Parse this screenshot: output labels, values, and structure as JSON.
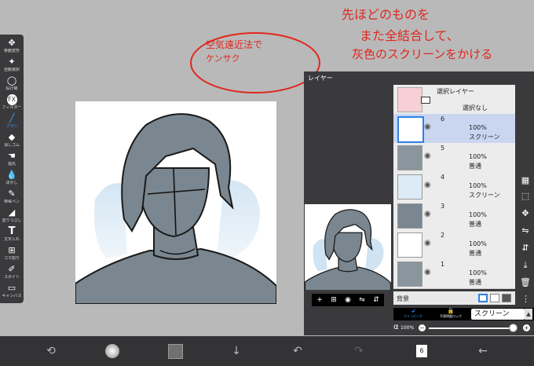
{
  "toolbar": {
    "tools": [
      {
        "label": "移動変形",
        "icon": "move-icon"
      },
      {
        "label": "自動選択",
        "icon": "magic-wand-icon"
      },
      {
        "label": "投げ縄",
        "icon": "lasso-icon"
      },
      {
        "label": "フィルター",
        "icon": "fx-icon"
      },
      {
        "label": "ブラシ",
        "icon": "brush-icon"
      },
      {
        "label": "消しゴム",
        "icon": "eraser-icon"
      },
      {
        "label": "指先",
        "icon": "finger-icon"
      },
      {
        "label": "ぼかし",
        "icon": "blur-icon"
      },
      {
        "label": "特殊ペン",
        "icon": "special-pen-icon"
      },
      {
        "label": "塗りつぶし",
        "icon": "fill-icon"
      },
      {
        "label": "文字入れ",
        "icon": "text-icon"
      },
      {
        "label": "コマ割り",
        "icon": "frame-icon"
      },
      {
        "label": "スポイト",
        "icon": "eyedropper-icon"
      },
      {
        "label": "キャンバス",
        "icon": "canvas-icon"
      }
    ],
    "active_index": 4
  },
  "annotations": {
    "left_line1": "空気遠近法で",
    "left_line2": "ケンサク",
    "right_line1": "先ほどのものを",
    "right_line2": "また全結合して、",
    "right_line3": "灰色のスクリーンをかける"
  },
  "layer_panel": {
    "title": "レイヤー",
    "selection_layer": {
      "label": "選択レイヤー",
      "sub": "選択なし"
    },
    "layers": [
      {
        "num": "6",
        "opacity": "100%",
        "mode": "スクリーン",
        "selected": true
      },
      {
        "num": "5",
        "opacity": "100%",
        "mode": "普通",
        "selected": false
      },
      {
        "num": "4",
        "opacity": "100%",
        "mode": "スクリーン",
        "selected": false
      },
      {
        "num": "3",
        "opacity": "100%",
        "mode": "普通",
        "selected": false
      },
      {
        "num": "2",
        "opacity": "100%",
        "mode": "普通",
        "selected": false
      },
      {
        "num": "1",
        "opacity": "100%",
        "mode": "普通",
        "selected": false
      }
    ],
    "background_label": "背景",
    "clipping_label": "クリッピング",
    "lock_label": "不透明度ロック",
    "blend_mode": "スクリーン",
    "alpha_symbol": "α",
    "alpha_value": "100%",
    "alpha_fraction": 1.0
  },
  "bottombar": {
    "layer_count": "6"
  },
  "colors": {
    "accent": "#2f80e8",
    "annotation": "#e0281e",
    "panel": "#3a3a3c",
    "figure": "#7a8790"
  }
}
